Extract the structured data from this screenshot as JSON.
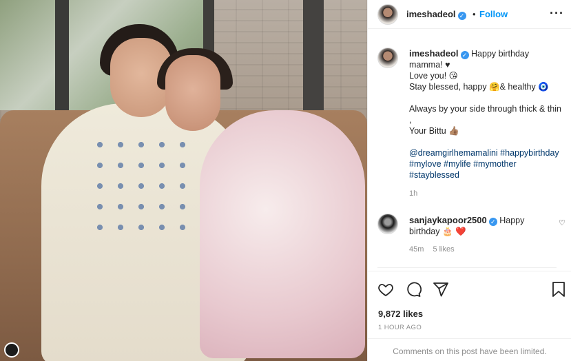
{
  "post": {
    "username": "imeshadeol",
    "verified_mark": "✓",
    "follow_label": "Follow",
    "more_icon": "more-horizontal-icon"
  },
  "caption": {
    "username": "imeshadeol",
    "line1": "Happy birthday mamma! ♥",
    "line2": "Love you! 😘",
    "line3": "Stay blessed, happy 🤗& healthy 🧿",
    "line4": "Always by your side through thick & thin ,",
    "line5": "Your Bittu 👍🏽",
    "tags": "@dreamgirlhemamalini #happybirthday #mylove #mylife #mymother #stayblessed",
    "time": "1h"
  },
  "comment": {
    "username": "sanjaykapoor2500",
    "text": "Happy birthday 🎂 ❤️",
    "time": "45m",
    "likes": "5 likes"
  },
  "stats": {
    "likes": "9,872 likes",
    "posted": "1 HOUR AGO",
    "comments_notice": "Comments on this post have been limited."
  }
}
